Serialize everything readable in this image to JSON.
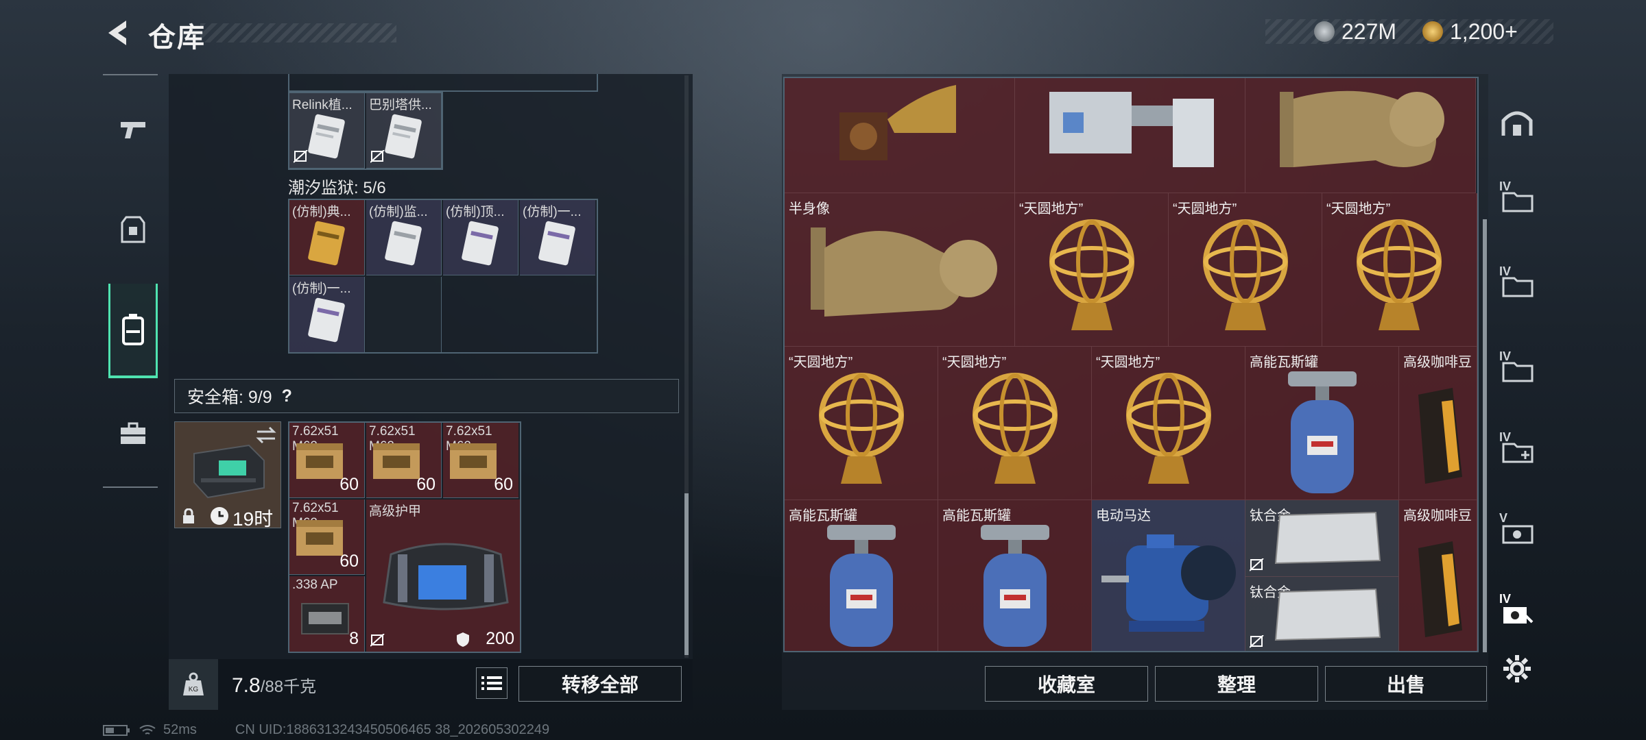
{
  "header": {
    "title": "仓库",
    "currency1": "227M",
    "currency2": "1,200+"
  },
  "left_grid_top": {
    "items": [
      {
        "name": "Relink植..."
      },
      {
        "name": "巴别塔供..."
      }
    ]
  },
  "tide_prison": {
    "label": "潮汐监狱: 5/6",
    "items": [
      {
        "name": "(仿制)典..."
      },
      {
        "name": "(仿制)监..."
      },
      {
        "name": "(仿制)顶..."
      },
      {
        "name": "(仿制)一..."
      },
      {
        "name": "(仿制)一..."
      }
    ]
  },
  "safe_box": {
    "label": "安全箱: 9/9",
    "help": "?",
    "case_timer": "19时",
    "items": [
      {
        "name": "7.62x51 M62",
        "count": "60"
      },
      {
        "name": "7.62x51 M62",
        "count": "60"
      },
      {
        "name": "7.62x51 M62",
        "count": "60"
      },
      {
        "name": "7.62x51 M62",
        "count": "60"
      },
      {
        "name": "高级护甲",
        "count": "200"
      },
      {
        "name": ".338 AP",
        "count": "8"
      }
    ]
  },
  "footer_left": {
    "weight_current": "7.8",
    "weight_max": "/88千克",
    "transfer_all": "转移全部"
  },
  "right_grid": {
    "items": [
      {
        "name": "半身像"
      },
      {
        "name": "“天圆地方”"
      },
      {
        "name": "“天圆地方”"
      },
      {
        "name": "“天圆地方”"
      },
      {
        "name": "“天圆地方”"
      },
      {
        "name": "“天圆地方”"
      },
      {
        "name": "“天圆地方”"
      },
      {
        "name": "高能瓦斯罐"
      },
      {
        "name": "高级咖啡豆"
      },
      {
        "name": "高能瓦斯罐"
      },
      {
        "name": "高能瓦斯罐"
      },
      {
        "name": "电动马达"
      },
      {
        "name": "钛合金"
      },
      {
        "name": "钛合金"
      },
      {
        "name": "高级咖啡豆"
      }
    ]
  },
  "footer_right": {
    "collection": "收藏室",
    "organize": "整理",
    "sell": "出售"
  },
  "right_nav": {
    "labels": [
      "IV",
      "IV",
      "IV",
      "IV",
      "V",
      "IV"
    ]
  },
  "status_bar": {
    "ping": "52ms",
    "uid": "CN UID:1886313243450506465 38_202605302249"
  },
  "colors": {
    "accent": "#4fe3b0",
    "item_red": "#5a2228",
    "gold": "#d9a640"
  }
}
